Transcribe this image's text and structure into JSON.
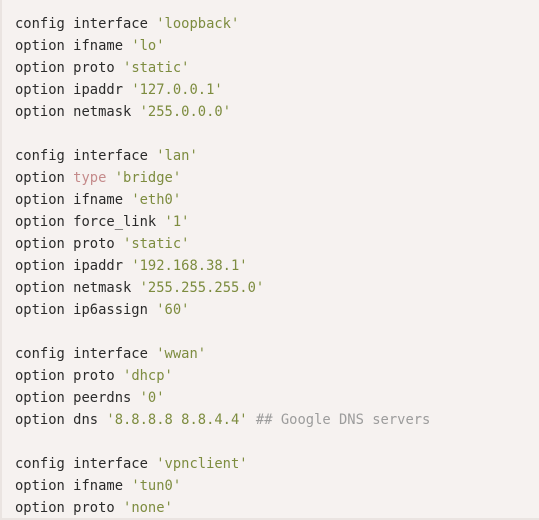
{
  "viewer": {
    "name": "uci-network-config-viewer",
    "background_color": "#f6f2f0",
    "border_color": "#eae4e1"
  },
  "theme": {
    "default_text_color": "#2b2b2b",
    "string_color": "#7d8c3f",
    "special_keyword_color": "#c58b8b",
    "comment_color": "#9c9c9c"
  },
  "code": {
    "language": "uci",
    "lines": [
      {
        "id": "line-1",
        "tokens": [
          {
            "text": "config",
            "kind": "kw"
          },
          {
            "text": " ",
            "kind": "plain"
          },
          {
            "text": "interface",
            "kind": "name"
          },
          {
            "text": " ",
            "kind": "plain"
          },
          {
            "text": "'loopback'",
            "kind": "str"
          }
        ]
      },
      {
        "id": "line-2",
        "tokens": [
          {
            "text": "option",
            "kind": "opt"
          },
          {
            "text": " ",
            "kind": "plain"
          },
          {
            "text": "ifname",
            "kind": "name"
          },
          {
            "text": " ",
            "kind": "plain"
          },
          {
            "text": "'lo'",
            "kind": "str"
          }
        ]
      },
      {
        "id": "line-3",
        "tokens": [
          {
            "text": "option",
            "kind": "opt"
          },
          {
            "text": " ",
            "kind": "plain"
          },
          {
            "text": "proto",
            "kind": "name"
          },
          {
            "text": " ",
            "kind": "plain"
          },
          {
            "text": "'static'",
            "kind": "str"
          }
        ]
      },
      {
        "id": "line-4",
        "tokens": [
          {
            "text": "option",
            "kind": "opt"
          },
          {
            "text": " ",
            "kind": "plain"
          },
          {
            "text": "ipaddr",
            "kind": "name"
          },
          {
            "text": " ",
            "kind": "plain"
          },
          {
            "text": "'127.0.0.1'",
            "kind": "str"
          }
        ]
      },
      {
        "id": "line-5",
        "tokens": [
          {
            "text": "option",
            "kind": "opt"
          },
          {
            "text": " ",
            "kind": "plain"
          },
          {
            "text": "netmask",
            "kind": "name"
          },
          {
            "text": " ",
            "kind": "plain"
          },
          {
            "text": "'255.0.0.0'",
            "kind": "str"
          }
        ]
      },
      {
        "id": "line-6",
        "tokens": []
      },
      {
        "id": "line-7",
        "tokens": [
          {
            "text": "config",
            "kind": "kw"
          },
          {
            "text": " ",
            "kind": "plain"
          },
          {
            "text": "interface",
            "kind": "name"
          },
          {
            "text": " ",
            "kind": "plain"
          },
          {
            "text": "'lan'",
            "kind": "str"
          }
        ]
      },
      {
        "id": "line-8",
        "tokens": [
          {
            "text": "option",
            "kind": "opt"
          },
          {
            "text": " ",
            "kind": "plain"
          },
          {
            "text": "type",
            "kind": "special"
          },
          {
            "text": " ",
            "kind": "plain"
          },
          {
            "text": "'bridge'",
            "kind": "str"
          }
        ]
      },
      {
        "id": "line-9",
        "tokens": [
          {
            "text": "option",
            "kind": "opt"
          },
          {
            "text": " ",
            "kind": "plain"
          },
          {
            "text": "ifname",
            "kind": "name"
          },
          {
            "text": " ",
            "kind": "plain"
          },
          {
            "text": "'eth0'",
            "kind": "str"
          }
        ]
      },
      {
        "id": "line-10",
        "tokens": [
          {
            "text": "option",
            "kind": "opt"
          },
          {
            "text": " ",
            "kind": "plain"
          },
          {
            "text": "force_link",
            "kind": "name"
          },
          {
            "text": " ",
            "kind": "plain"
          },
          {
            "text": "'1'",
            "kind": "str"
          }
        ]
      },
      {
        "id": "line-11",
        "tokens": [
          {
            "text": "option",
            "kind": "opt"
          },
          {
            "text": " ",
            "kind": "plain"
          },
          {
            "text": "proto",
            "kind": "name"
          },
          {
            "text": " ",
            "kind": "plain"
          },
          {
            "text": "'static'",
            "kind": "str"
          }
        ]
      },
      {
        "id": "line-12",
        "tokens": [
          {
            "text": "option",
            "kind": "opt"
          },
          {
            "text": " ",
            "kind": "plain"
          },
          {
            "text": "ipaddr",
            "kind": "name"
          },
          {
            "text": " ",
            "kind": "plain"
          },
          {
            "text": "'192.168.38.1'",
            "kind": "str"
          }
        ]
      },
      {
        "id": "line-13",
        "tokens": [
          {
            "text": "option",
            "kind": "opt"
          },
          {
            "text": " ",
            "kind": "plain"
          },
          {
            "text": "netmask",
            "kind": "name"
          },
          {
            "text": " ",
            "kind": "plain"
          },
          {
            "text": "'255.255.255.0'",
            "kind": "str"
          }
        ]
      },
      {
        "id": "line-14",
        "tokens": [
          {
            "text": "option",
            "kind": "opt"
          },
          {
            "text": " ",
            "kind": "plain"
          },
          {
            "text": "ip6assign",
            "kind": "name"
          },
          {
            "text": " ",
            "kind": "plain"
          },
          {
            "text": "'60'",
            "kind": "str"
          }
        ]
      },
      {
        "id": "line-15",
        "tokens": []
      },
      {
        "id": "line-16",
        "tokens": [
          {
            "text": "config",
            "kind": "kw"
          },
          {
            "text": " ",
            "kind": "plain"
          },
          {
            "text": "interface",
            "kind": "name"
          },
          {
            "text": " ",
            "kind": "plain"
          },
          {
            "text": "'wwan'",
            "kind": "str"
          }
        ]
      },
      {
        "id": "line-17",
        "tokens": [
          {
            "text": "option",
            "kind": "opt"
          },
          {
            "text": " ",
            "kind": "plain"
          },
          {
            "text": "proto",
            "kind": "name"
          },
          {
            "text": " ",
            "kind": "plain"
          },
          {
            "text": "'dhcp'",
            "kind": "str"
          }
        ]
      },
      {
        "id": "line-18",
        "tokens": [
          {
            "text": "option",
            "kind": "opt"
          },
          {
            "text": " ",
            "kind": "plain"
          },
          {
            "text": "peerdns",
            "kind": "name"
          },
          {
            "text": " ",
            "kind": "plain"
          },
          {
            "text": "'0'",
            "kind": "str"
          }
        ]
      },
      {
        "id": "line-19",
        "tokens": [
          {
            "text": "option",
            "kind": "opt"
          },
          {
            "text": " ",
            "kind": "plain"
          },
          {
            "text": "dns",
            "kind": "name"
          },
          {
            "text": " ",
            "kind": "plain"
          },
          {
            "text": "'8.8.8.8 8.8.4.4'",
            "kind": "str"
          },
          {
            "text": " ",
            "kind": "plain"
          },
          {
            "text": "## Google DNS servers",
            "kind": "comment"
          }
        ]
      },
      {
        "id": "line-20",
        "tokens": []
      },
      {
        "id": "line-21",
        "tokens": [
          {
            "text": "config",
            "kind": "kw"
          },
          {
            "text": " ",
            "kind": "plain"
          },
          {
            "text": "interface",
            "kind": "name"
          },
          {
            "text": " ",
            "kind": "plain"
          },
          {
            "text": "'vpnclient'",
            "kind": "str"
          }
        ]
      },
      {
        "id": "line-22",
        "tokens": [
          {
            "text": "option",
            "kind": "opt"
          },
          {
            "text": " ",
            "kind": "plain"
          },
          {
            "text": "ifname",
            "kind": "name"
          },
          {
            "text": " ",
            "kind": "plain"
          },
          {
            "text": "'tun0'",
            "kind": "str"
          }
        ]
      },
      {
        "id": "line-23",
        "tokens": [
          {
            "text": "option",
            "kind": "opt"
          },
          {
            "text": " ",
            "kind": "plain"
          },
          {
            "text": "proto",
            "kind": "name"
          },
          {
            "text": " ",
            "kind": "plain"
          },
          {
            "text": "'none'",
            "kind": "str"
          }
        ]
      }
    ]
  }
}
